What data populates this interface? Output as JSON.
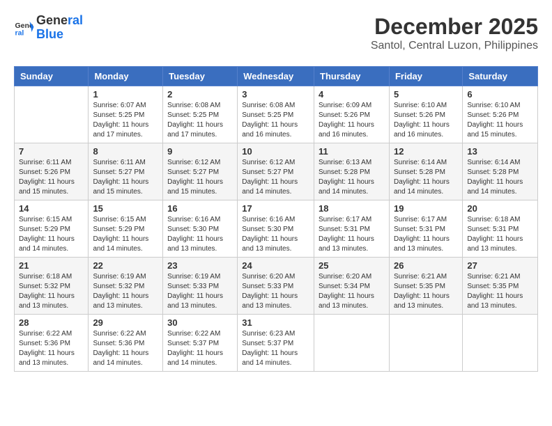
{
  "header": {
    "logo_line1": "General",
    "logo_line2": "Blue",
    "month": "December 2025",
    "location": "Santol, Central Luzon, Philippines"
  },
  "weekdays": [
    "Sunday",
    "Monday",
    "Tuesday",
    "Wednesday",
    "Thursday",
    "Friday",
    "Saturday"
  ],
  "weeks": [
    [
      {
        "day": "",
        "sunrise": "",
        "sunset": "",
        "daylight": ""
      },
      {
        "day": "1",
        "sunrise": "Sunrise: 6:07 AM",
        "sunset": "Sunset: 5:25 PM",
        "daylight": "Daylight: 11 hours and 17 minutes."
      },
      {
        "day": "2",
        "sunrise": "Sunrise: 6:08 AM",
        "sunset": "Sunset: 5:25 PM",
        "daylight": "Daylight: 11 hours and 17 minutes."
      },
      {
        "day": "3",
        "sunrise": "Sunrise: 6:08 AM",
        "sunset": "Sunset: 5:25 PM",
        "daylight": "Daylight: 11 hours and 16 minutes."
      },
      {
        "day": "4",
        "sunrise": "Sunrise: 6:09 AM",
        "sunset": "Sunset: 5:26 PM",
        "daylight": "Daylight: 11 hours and 16 minutes."
      },
      {
        "day": "5",
        "sunrise": "Sunrise: 6:10 AM",
        "sunset": "Sunset: 5:26 PM",
        "daylight": "Daylight: 11 hours and 16 minutes."
      },
      {
        "day": "6",
        "sunrise": "Sunrise: 6:10 AM",
        "sunset": "Sunset: 5:26 PM",
        "daylight": "Daylight: 11 hours and 15 minutes."
      }
    ],
    [
      {
        "day": "7",
        "sunrise": "Sunrise: 6:11 AM",
        "sunset": "Sunset: 5:26 PM",
        "daylight": "Daylight: 11 hours and 15 minutes."
      },
      {
        "day": "8",
        "sunrise": "Sunrise: 6:11 AM",
        "sunset": "Sunset: 5:27 PM",
        "daylight": "Daylight: 11 hours and 15 minutes."
      },
      {
        "day": "9",
        "sunrise": "Sunrise: 6:12 AM",
        "sunset": "Sunset: 5:27 PM",
        "daylight": "Daylight: 11 hours and 15 minutes."
      },
      {
        "day": "10",
        "sunrise": "Sunrise: 6:12 AM",
        "sunset": "Sunset: 5:27 PM",
        "daylight": "Daylight: 11 hours and 14 minutes."
      },
      {
        "day": "11",
        "sunrise": "Sunrise: 6:13 AM",
        "sunset": "Sunset: 5:28 PM",
        "daylight": "Daylight: 11 hours and 14 minutes."
      },
      {
        "day": "12",
        "sunrise": "Sunrise: 6:14 AM",
        "sunset": "Sunset: 5:28 PM",
        "daylight": "Daylight: 11 hours and 14 minutes."
      },
      {
        "day": "13",
        "sunrise": "Sunrise: 6:14 AM",
        "sunset": "Sunset: 5:28 PM",
        "daylight": "Daylight: 11 hours and 14 minutes."
      }
    ],
    [
      {
        "day": "14",
        "sunrise": "Sunrise: 6:15 AM",
        "sunset": "Sunset: 5:29 PM",
        "daylight": "Daylight: 11 hours and 14 minutes."
      },
      {
        "day": "15",
        "sunrise": "Sunrise: 6:15 AM",
        "sunset": "Sunset: 5:29 PM",
        "daylight": "Daylight: 11 hours and 14 minutes."
      },
      {
        "day": "16",
        "sunrise": "Sunrise: 6:16 AM",
        "sunset": "Sunset: 5:30 PM",
        "daylight": "Daylight: 11 hours and 13 minutes."
      },
      {
        "day": "17",
        "sunrise": "Sunrise: 6:16 AM",
        "sunset": "Sunset: 5:30 PM",
        "daylight": "Daylight: 11 hours and 13 minutes."
      },
      {
        "day": "18",
        "sunrise": "Sunrise: 6:17 AM",
        "sunset": "Sunset: 5:31 PM",
        "daylight": "Daylight: 11 hours and 13 minutes."
      },
      {
        "day": "19",
        "sunrise": "Sunrise: 6:17 AM",
        "sunset": "Sunset: 5:31 PM",
        "daylight": "Daylight: 11 hours and 13 minutes."
      },
      {
        "day": "20",
        "sunrise": "Sunrise: 6:18 AM",
        "sunset": "Sunset: 5:31 PM",
        "daylight": "Daylight: 11 hours and 13 minutes."
      }
    ],
    [
      {
        "day": "21",
        "sunrise": "Sunrise: 6:18 AM",
        "sunset": "Sunset: 5:32 PM",
        "daylight": "Daylight: 11 hours and 13 minutes."
      },
      {
        "day": "22",
        "sunrise": "Sunrise: 6:19 AM",
        "sunset": "Sunset: 5:32 PM",
        "daylight": "Daylight: 11 hours and 13 minutes."
      },
      {
        "day": "23",
        "sunrise": "Sunrise: 6:19 AM",
        "sunset": "Sunset: 5:33 PM",
        "daylight": "Daylight: 11 hours and 13 minutes."
      },
      {
        "day": "24",
        "sunrise": "Sunrise: 6:20 AM",
        "sunset": "Sunset: 5:33 PM",
        "daylight": "Daylight: 11 hours and 13 minutes."
      },
      {
        "day": "25",
        "sunrise": "Sunrise: 6:20 AM",
        "sunset": "Sunset: 5:34 PM",
        "daylight": "Daylight: 11 hours and 13 minutes."
      },
      {
        "day": "26",
        "sunrise": "Sunrise: 6:21 AM",
        "sunset": "Sunset: 5:35 PM",
        "daylight": "Daylight: 11 hours and 13 minutes."
      },
      {
        "day": "27",
        "sunrise": "Sunrise: 6:21 AM",
        "sunset": "Sunset: 5:35 PM",
        "daylight": "Daylight: 11 hours and 13 minutes."
      }
    ],
    [
      {
        "day": "28",
        "sunrise": "Sunrise: 6:22 AM",
        "sunset": "Sunset: 5:36 PM",
        "daylight": "Daylight: 11 hours and 13 minutes."
      },
      {
        "day": "29",
        "sunrise": "Sunrise: 6:22 AM",
        "sunset": "Sunset: 5:36 PM",
        "daylight": "Daylight: 11 hours and 14 minutes."
      },
      {
        "day": "30",
        "sunrise": "Sunrise: 6:22 AM",
        "sunset": "Sunset: 5:37 PM",
        "daylight": "Daylight: 11 hours and 14 minutes."
      },
      {
        "day": "31",
        "sunrise": "Sunrise: 6:23 AM",
        "sunset": "Sunset: 5:37 PM",
        "daylight": "Daylight: 11 hours and 14 minutes."
      },
      {
        "day": "",
        "sunrise": "",
        "sunset": "",
        "daylight": ""
      },
      {
        "day": "",
        "sunrise": "",
        "sunset": "",
        "daylight": ""
      },
      {
        "day": "",
        "sunrise": "",
        "sunset": "",
        "daylight": ""
      }
    ]
  ]
}
